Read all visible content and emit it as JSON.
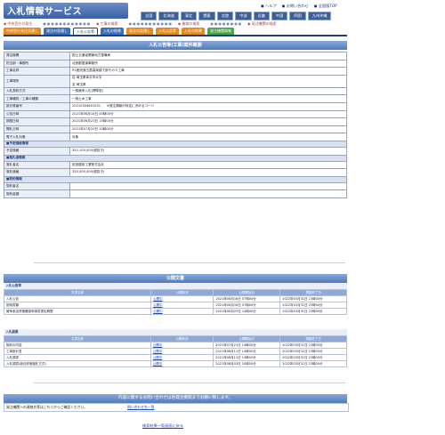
{
  "header": {
    "site_title": "入札情報サービス",
    "top_links": [
      "ヘルプ",
      "お問い合わせ",
      "全国版TOP"
    ],
    "regions": [
      {
        "label": "全国",
        "active": false
      },
      {
        "label": "北海道",
        "active": false
      },
      {
        "label": "東北",
        "active": false
      },
      {
        "label": "関東",
        "active": true
      },
      {
        "label": "北陸",
        "active": false
      },
      {
        "label": "中部",
        "active": false
      },
      {
        "label": "近畿",
        "active": false
      },
      {
        "label": "中国",
        "active": false
      },
      {
        "label": "四国",
        "active": false
      },
      {
        "label": "九州沖縄",
        "active": false
      }
    ]
  },
  "subnav": {
    "item1": "中央官庁の発注",
    "item2": "工事の検索",
    "item3": "業務の検索",
    "item4": "発注機関の検索"
  },
  "tabs": [
    {
      "label": "中央官庁発注見通し",
      "color": "orange"
    },
    {
      "label": "発注の見通し",
      "color": "blue"
    },
    {
      "label": "入札公告等",
      "color": "active"
    },
    {
      "label": "入札の結果",
      "color": "blue"
    },
    {
      "label": "発注の見通し",
      "color": "orange"
    },
    {
      "label": "入札公告等",
      "color": "orange"
    },
    {
      "label": "入札の結果",
      "color": "orange"
    },
    {
      "label": "発注機関情報",
      "color": "green"
    }
  ],
  "main": {
    "section_title": "入札公告等(工事)案件概要",
    "rows": [
      {
        "label": "発注機関",
        "value": "国土交通省関東地方整備局"
      },
      {
        "label": "担当部・事務所",
        "value": "北首都国道事務所"
      },
      {
        "label": "工事名称",
        "value": "R1圏央道五霞高架橋下部その５工事"
      },
      {
        "label": "工事場所",
        "value": "自 埼玉県幸手市大字",
        "value2": "至 埼玉県"
      },
      {
        "label": "入札契約方式",
        "value": "一般競争入札(標準型)"
      },
      {
        "label": "工事種別／工事の種類",
        "value": "一般土木工事"
      },
      {
        "label": "設計書番号",
        "value": "20210304601031",
        "note": "※発注情報が特定に決めるコード"
      },
      {
        "label": "公告日時",
        "value": "2021年06月16日 00時00分"
      },
      {
        "label": "期限日時",
        "value": "2021年06月23日 15時00分"
      },
      {
        "label": "開札日時",
        "value": "2021年07月20日 10時00分"
      },
      {
        "label": "電子入札対象",
        "value": "対象"
      }
    ],
    "group_estimate": "■予定価格情報",
    "estimate_rows": [
      {
        "label": "予定価格",
        "value": "352,100,000(税抜き)"
      }
    ],
    "group_winner": "■落札者情報",
    "winner_rows": [
      {
        "label": "落札者名",
        "value": "前田建設工業株式会社"
      },
      {
        "label": "落札価格",
        "value": "330,000,000(税抜き)"
      }
    ],
    "group_contract": "■契約情報",
    "contract_rows": [
      {
        "label": "契約者名",
        "value": ""
      },
      {
        "label": "契約金額",
        "value": ""
      }
    ]
  },
  "docs": {
    "section_title": "公開文書",
    "notice_title": "入札公告等",
    "headers": [
      "文書名称",
      "公開状況",
      "公開開始日",
      "掲載終了日"
    ],
    "notice_rows": [
      {
        "name": "入札公告",
        "status": "公開中",
        "start": "2021年06月16日 07時00分",
        "end": "2022年03月31日 23時00分"
      },
      {
        "name": "説明書類",
        "status": "公開中",
        "start": "2021年06月16日 07時00分",
        "end": "2022年03月31日 23時00分"
      },
      {
        "name": "競争参加資格確認申請書提出期限",
        "status": "公開中",
        "start": "2021年06月23日 14時00分",
        "end": "2022年03月31日 23時00分"
      }
    ],
    "result_title": "入札結果",
    "result_rows": [
      {
        "name": "契約の内容",
        "status": "公開中",
        "start": "2021年07月21日 14時00分",
        "end": "2022年03月31日 23時00分"
      },
      {
        "name": "工事設計書",
        "status": "公開中",
        "start": "2021年08月11日 14時00分",
        "end": "2022年03月31日 23時00分"
      },
      {
        "name": "入札調書",
        "status": "公開中",
        "start": "2021年08月11日 14時00分",
        "end": "2022年03月31日 23時00分"
      },
      {
        "name": "入札調書(総合評価落札方式)",
        "status": "公開中",
        "start": "2021年08月03日 20時00分",
        "end": "2022年03月31日 23時00分"
      }
    ]
  },
  "contact": {
    "banner": "内容に関するお問い合わせは各発注機関までお願い致します。",
    "label": "発注機関への連絡先等はこちらからご確認ください。",
    "link": "問い合わせ先一覧"
  },
  "footer": {
    "back_link": "検索結果一覧画面に戻る"
  }
}
